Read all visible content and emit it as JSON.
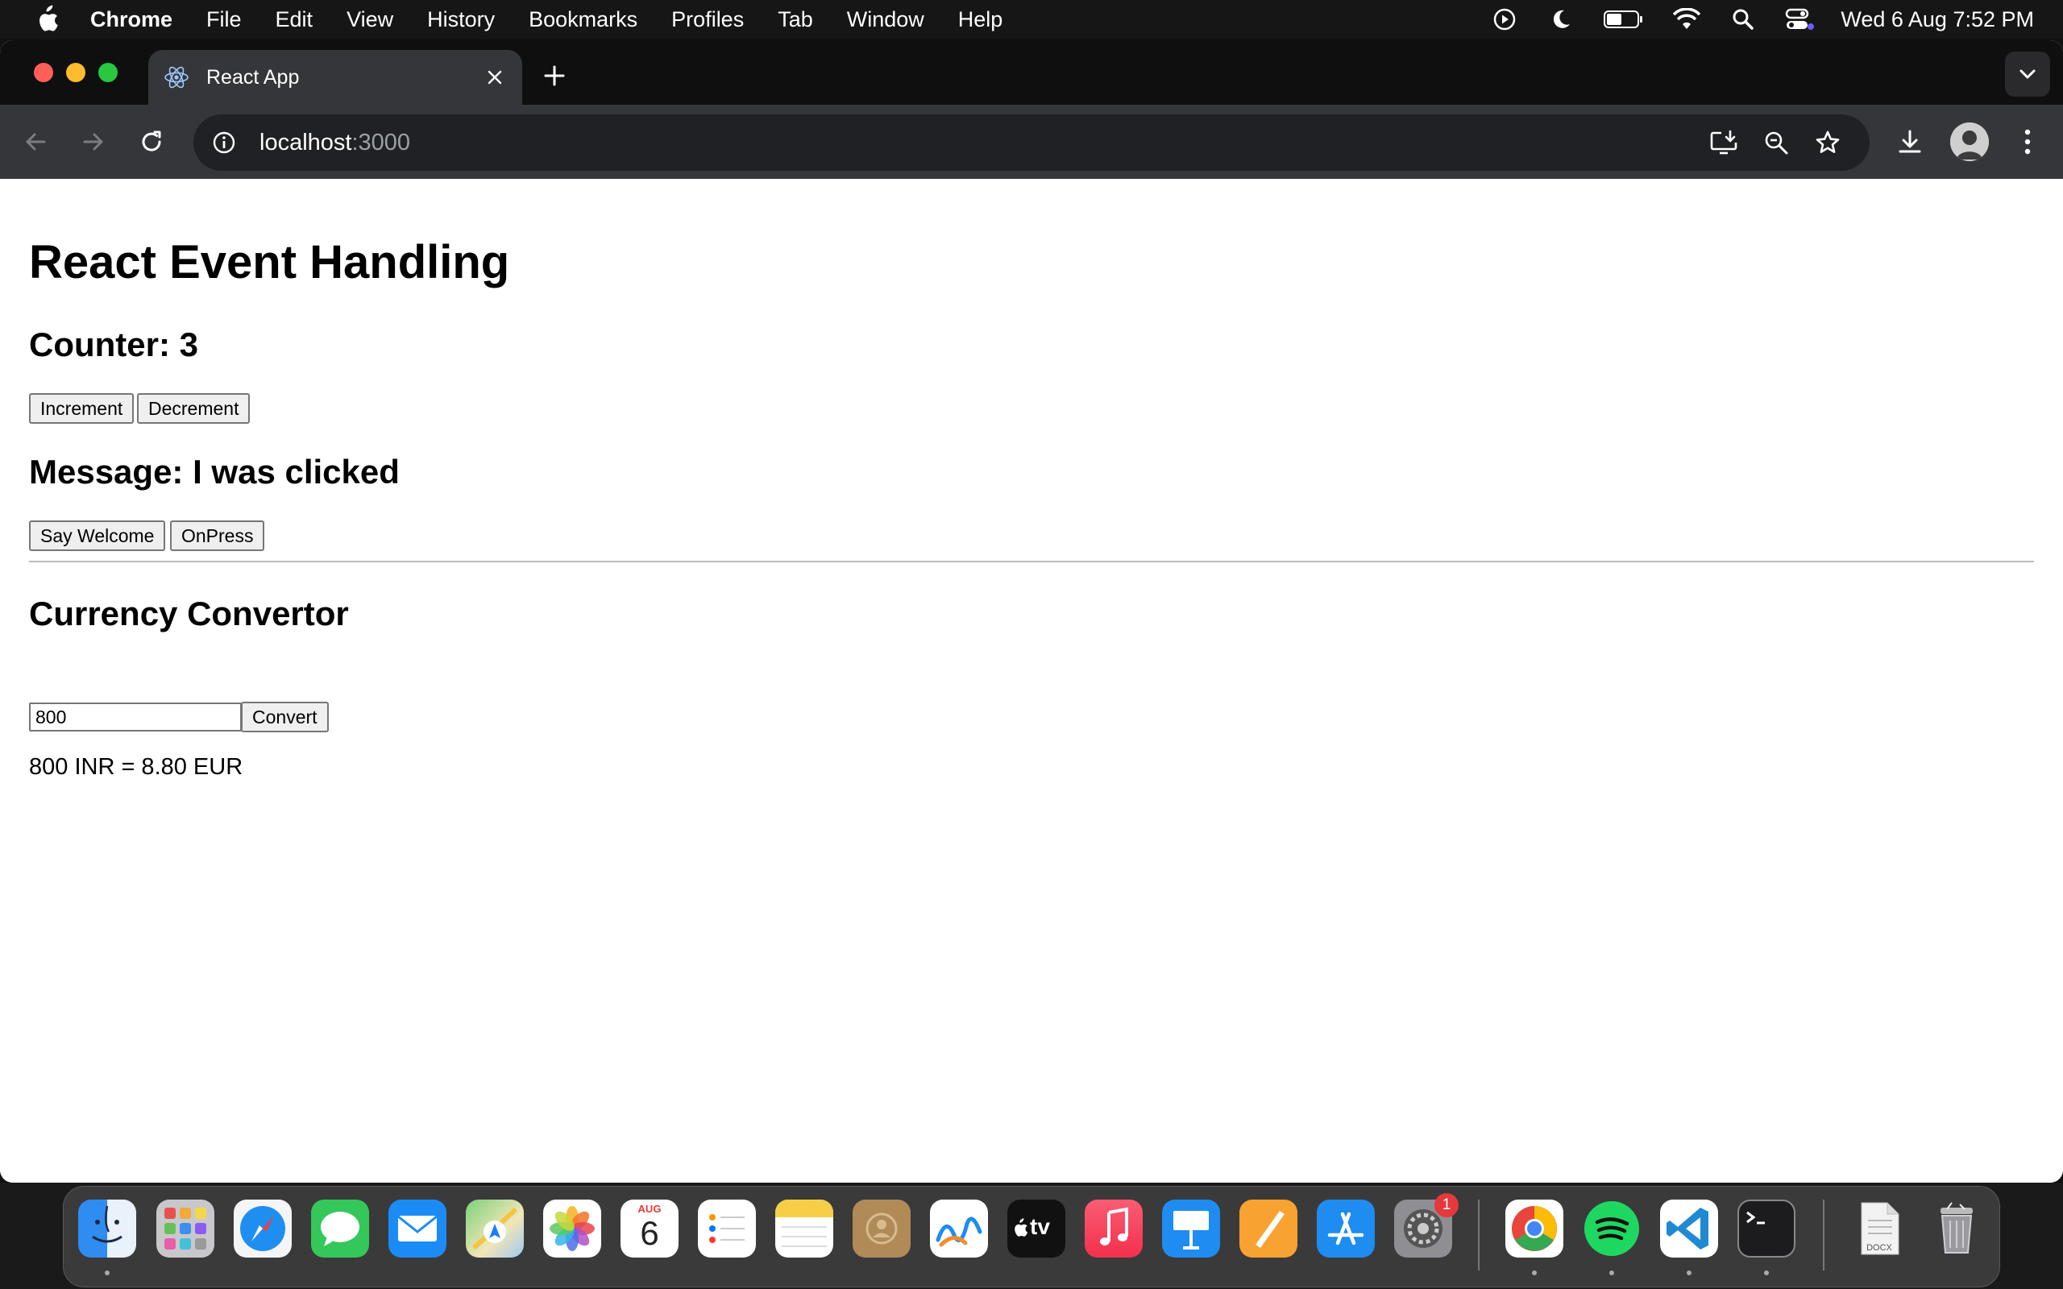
{
  "menubar": {
    "app_name": "Chrome",
    "items": [
      "File",
      "Edit",
      "View",
      "History",
      "Bookmarks",
      "Profiles",
      "Tab",
      "Window",
      "Help"
    ],
    "clock": "Wed 6 Aug  7:52 PM",
    "status_icons": [
      "play-circle-icon",
      "moon-icon",
      "battery-icon",
      "wifi-icon",
      "spotlight-search-icon",
      "control-center-icon"
    ]
  },
  "browser": {
    "tab_title": "React App",
    "url_host": "localhost",
    "url_port": ":3000",
    "colors": {
      "tab_bg": "#35363a",
      "strip_bg": "#0f0f10",
      "omnibox_bg": "#202124"
    }
  },
  "page": {
    "heading": "React Event Handling",
    "counter_label": "Counter: 3",
    "increment_label": "Increment",
    "decrement_label": "Decrement",
    "message_label": "Message: I was clicked",
    "say_welcome_label": "Say Welcome",
    "onpress_label": "OnPress",
    "currency_heading": "Currency Convertor",
    "amount_value": "800",
    "convert_label": "Convert",
    "result_text": "800 INR = 8.80 EUR"
  },
  "dock": {
    "apps": [
      "Finder",
      "Launchpad",
      "Safari",
      "Messages",
      "Mail",
      "Maps",
      "Photos",
      "Calendar",
      "Reminders",
      "Notes",
      "Contacts",
      "Freeform",
      "TV",
      "Music",
      "Keynote",
      "Pages",
      "App Store",
      "System Settings",
      "Chrome",
      "Spotify",
      "Visual Studio Code",
      "Terminal",
      "Document",
      "Trash"
    ],
    "calendar_month": "AUG",
    "calendar_day": "6",
    "tv_label": "tv",
    "settings_badge": "1",
    "doc_label": "DOCX"
  }
}
